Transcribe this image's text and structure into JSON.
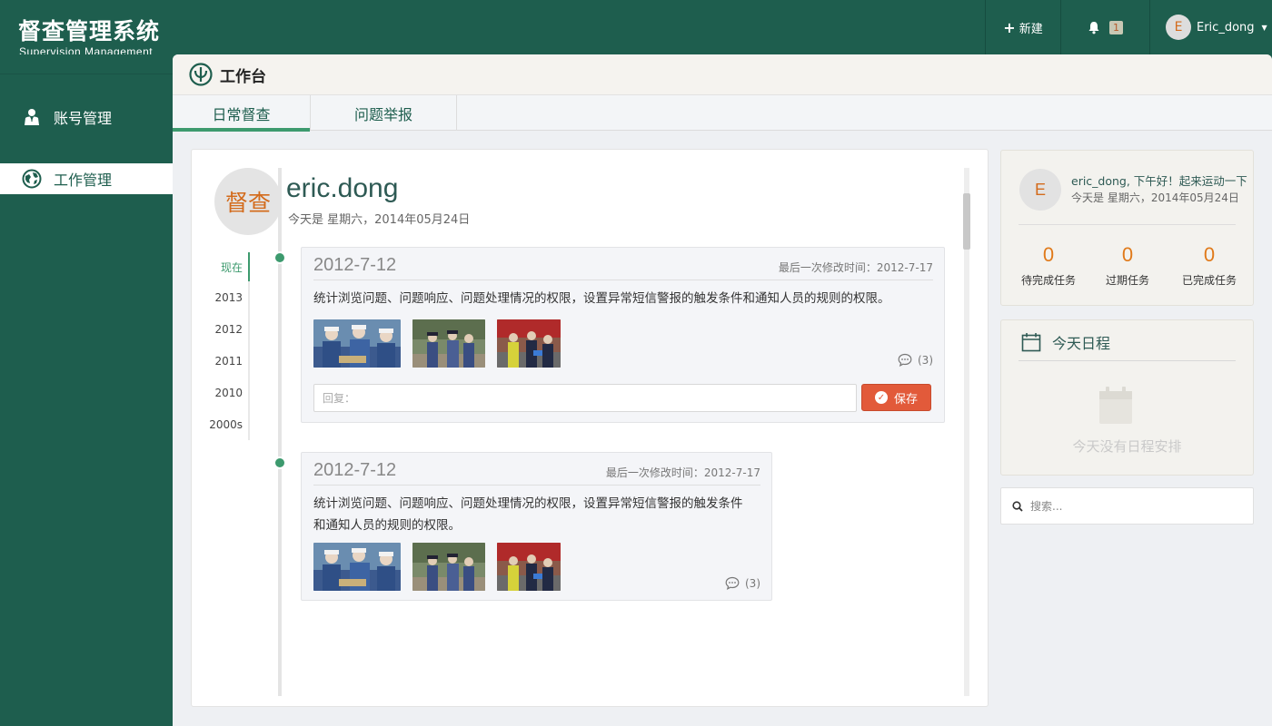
{
  "app": {
    "title": "督查管理系统",
    "subtitle": "Supervision Management"
  },
  "topbar": {
    "new_label": "新建",
    "notifications": "1",
    "user": "Eric_dong",
    "user_initial": "E"
  },
  "sidebar": {
    "items": [
      {
        "label": "账号管理",
        "icon": "user-icon"
      },
      {
        "label": "工作管理",
        "icon": "globe-icon"
      }
    ]
  },
  "header": {
    "title": "工作台"
  },
  "tabs": [
    {
      "label": "日常督查",
      "active": true
    },
    {
      "label": "问题举报",
      "active": false
    }
  ],
  "profile": {
    "avatar_text": "督查",
    "name": "eric.dong",
    "date": "今天是 星期六，2014年05月24日"
  },
  "years": [
    "现在",
    "2013",
    "2012",
    "2011",
    "2010",
    "2000s"
  ],
  "posts": [
    {
      "date": "2012-7-12",
      "modified": "最后一次修改时间：2012-7-17",
      "text": "统计浏览问题、问题响应、问题处理情况的权限，设置异常短信警报的触发条件和通知人员的规则的权限。",
      "comments": "(3)",
      "reply_placeholder": "回复：",
      "save_label": "保存"
    },
    {
      "date": "2012-7-12",
      "modified": "最后一次修改时间：2012-7-17",
      "text_line1": "统计浏览问题、问题响应、问题处理情况的权限，设置异常短信警报的触发条件",
      "text_line2": "和通知人员的规则的权限。",
      "comments": "(3)"
    }
  ],
  "welcome": {
    "initial": "E",
    "greeting": "eric_dong, 下午好！起来运动一下",
    "date": "今天是 星期六，2014年05月24日",
    "stats": [
      {
        "value": "0",
        "label": "待完成任务"
      },
      {
        "value": "0",
        "label": "过期任务"
      },
      {
        "value": "0",
        "label": "已完成任务"
      }
    ]
  },
  "schedule": {
    "title": "今天日程",
    "empty": "今天没有日程安排"
  },
  "search": {
    "placeholder": "搜索..."
  },
  "colors": {
    "brand": "#1e5e4e",
    "accent": "#3d9a6e",
    "save": "#e25a3a",
    "stat": "#e07a1a"
  }
}
